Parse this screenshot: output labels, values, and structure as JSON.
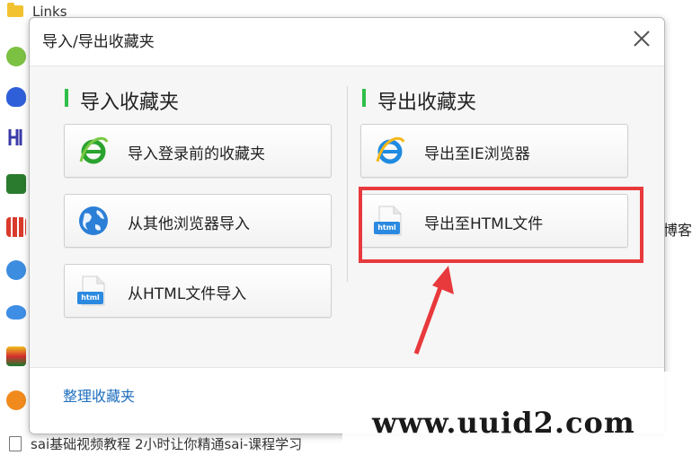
{
  "background": {
    "folder_label": "Links",
    "right_fragment": "博客",
    "bottom_item": "sai基础视频教程 2小时让你精通sai-课程学习"
  },
  "dialog": {
    "title": "导入/导出收藏夹",
    "import_section": {
      "heading": "导入收藏夹",
      "buttons": [
        {
          "label": "导入登录前的收藏夹",
          "icon": "ie-icon"
        },
        {
          "label": "从其他浏览器导入",
          "icon": "globe-icon"
        },
        {
          "label": "从HTML文件导入",
          "icon": "html-file-icon"
        }
      ]
    },
    "export_section": {
      "heading": "导出收藏夹",
      "buttons": [
        {
          "label": "导出至IE浏览器",
          "icon": "ie-icon"
        },
        {
          "label": "导出至HTML文件",
          "icon": "html-file-icon"
        }
      ]
    },
    "manage_link": "整理收藏夹",
    "html_badge": "html"
  },
  "watermark": "www.uuid2.com",
  "colors": {
    "accent_bar": "#2fbf4a",
    "highlight": "#e8393c",
    "link": "#1f6fbf"
  }
}
